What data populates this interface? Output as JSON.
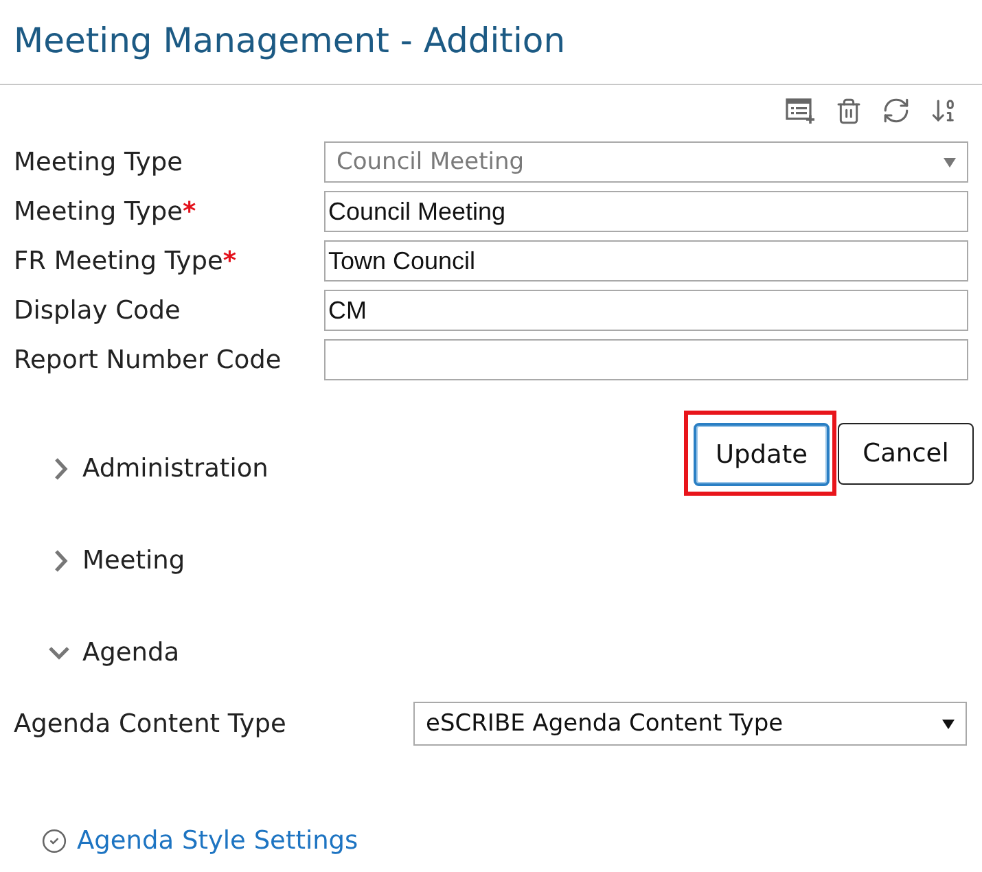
{
  "page": {
    "title": "Meeting Management - Addition"
  },
  "fields": [
    {
      "label": "Meeting Type",
      "kind": "select",
      "value": "Council Meeting",
      "disabled": true
    },
    {
      "label": "Meeting Type",
      "required_mark": "*",
      "kind": "text",
      "value": "Council Meeting",
      "disabled": false
    },
    {
      "label": "FR Meeting Type",
      "required_mark": "*",
      "kind": "text",
      "value": "Town Council",
      "disabled": false
    },
    {
      "label": "Display Code",
      "kind": "text",
      "value": "CM",
      "disabled": false
    },
    {
      "label": "Report Number Code",
      "kind": "text",
      "disabled": false
    }
  ],
  "buttons": [
    {
      "label": "Update",
      "focused": true,
      "highlighted": true
    },
    {
      "label": "Cancel",
      "focused": false,
      "highlighted": false
    }
  ],
  "sections": [
    {
      "title": "Administration",
      "expanded": false
    },
    {
      "title": "Meeting",
      "expanded": false
    },
    {
      "title": "Agenda",
      "expanded": true,
      "fields": [
        {
          "label": "Agenda Content Type",
          "kind": "select",
          "value": "eSCRIBE Agenda Content Type",
          "disabled": false
        }
      ],
      "links": [
        {
          "label": "Agenda Style Settings"
        }
      ]
    }
  ]
}
